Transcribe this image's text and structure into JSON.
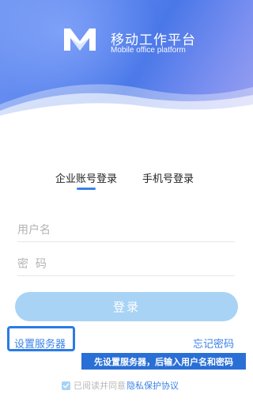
{
  "header": {
    "app_title": "移动工作平台",
    "app_subtitle": "Mobile office platform",
    "gradient_colors": [
      "#6f95f2",
      "#4a78e8",
      "#9aa0ef"
    ]
  },
  "tabs": [
    {
      "label": "企业账号登录",
      "active": true
    },
    {
      "label": "手机号登录",
      "active": false
    }
  ],
  "form": {
    "username_placeholder": "用户名",
    "password_placeholder": "密  码",
    "username_value": "",
    "password_value": ""
  },
  "login_button": {
    "label": "登录",
    "color": "#a8d3f5"
  },
  "links": {
    "server_settings": "设置服务器",
    "forgot_password": "忘记密码"
  },
  "hint": "先设置服务器，后输入用户名和密码",
  "agreement": {
    "checked": true,
    "text": "已阅读并同意",
    "privacy_link": "隐私保护协议"
  },
  "colors": {
    "accent": "#3b82e6",
    "highlight": "#2a7be6"
  }
}
